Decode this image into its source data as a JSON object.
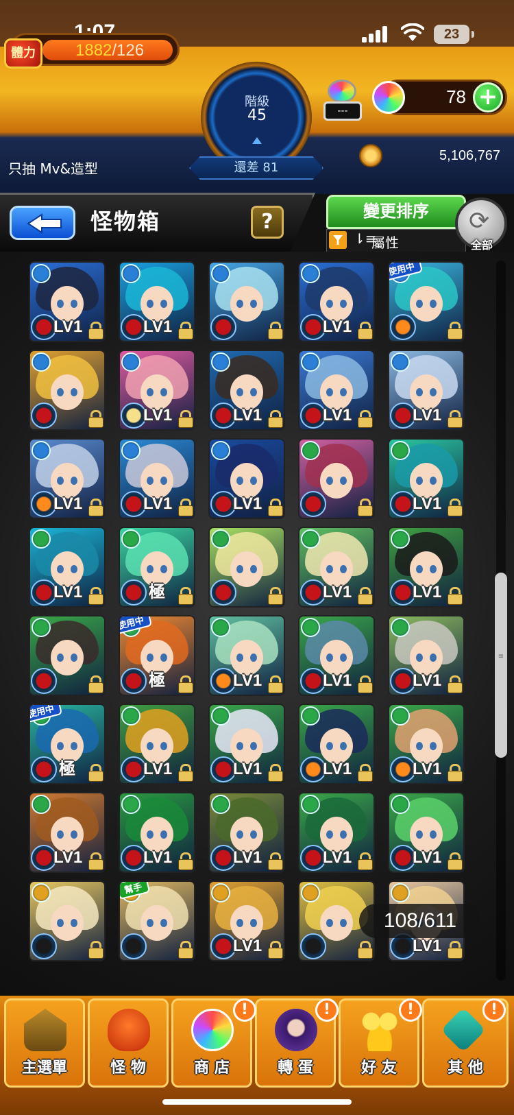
{
  "status_bar": {
    "time": "1:07",
    "battery": "23"
  },
  "header": {
    "stamina_label": "體力",
    "stamina_current": "1882",
    "stamina_max": "/126",
    "rank_label": "階級",
    "rank_value": "45",
    "stamina_item_value": "---",
    "gem_count": "78",
    "gem_plus": "+",
    "nickname": "只抽 Mv&造型",
    "rank_diff": "還差 81",
    "coins": "5,106,767"
  },
  "titlebar": {
    "title": "怪物箱",
    "help": "?",
    "sort_button": "變更排序",
    "filter_label": "屬性",
    "all_label": "全部"
  },
  "grid": {
    "level_text": "LV1",
    "max_text": "極",
    "in_use_tag": "使用中",
    "helper_tag": "幫手",
    "count": "108/611"
  },
  "bottom_nav": [
    {
      "label": "主選單",
      "badge": ""
    },
    {
      "label": "怪 物",
      "badge": ""
    },
    {
      "label": "商 店",
      "badge": "!"
    },
    {
      "label": "轉 蛋",
      "badge": "!"
    },
    {
      "label": "好 友",
      "badge": "!"
    },
    {
      "label": "其 他",
      "badge": "!"
    }
  ]
}
